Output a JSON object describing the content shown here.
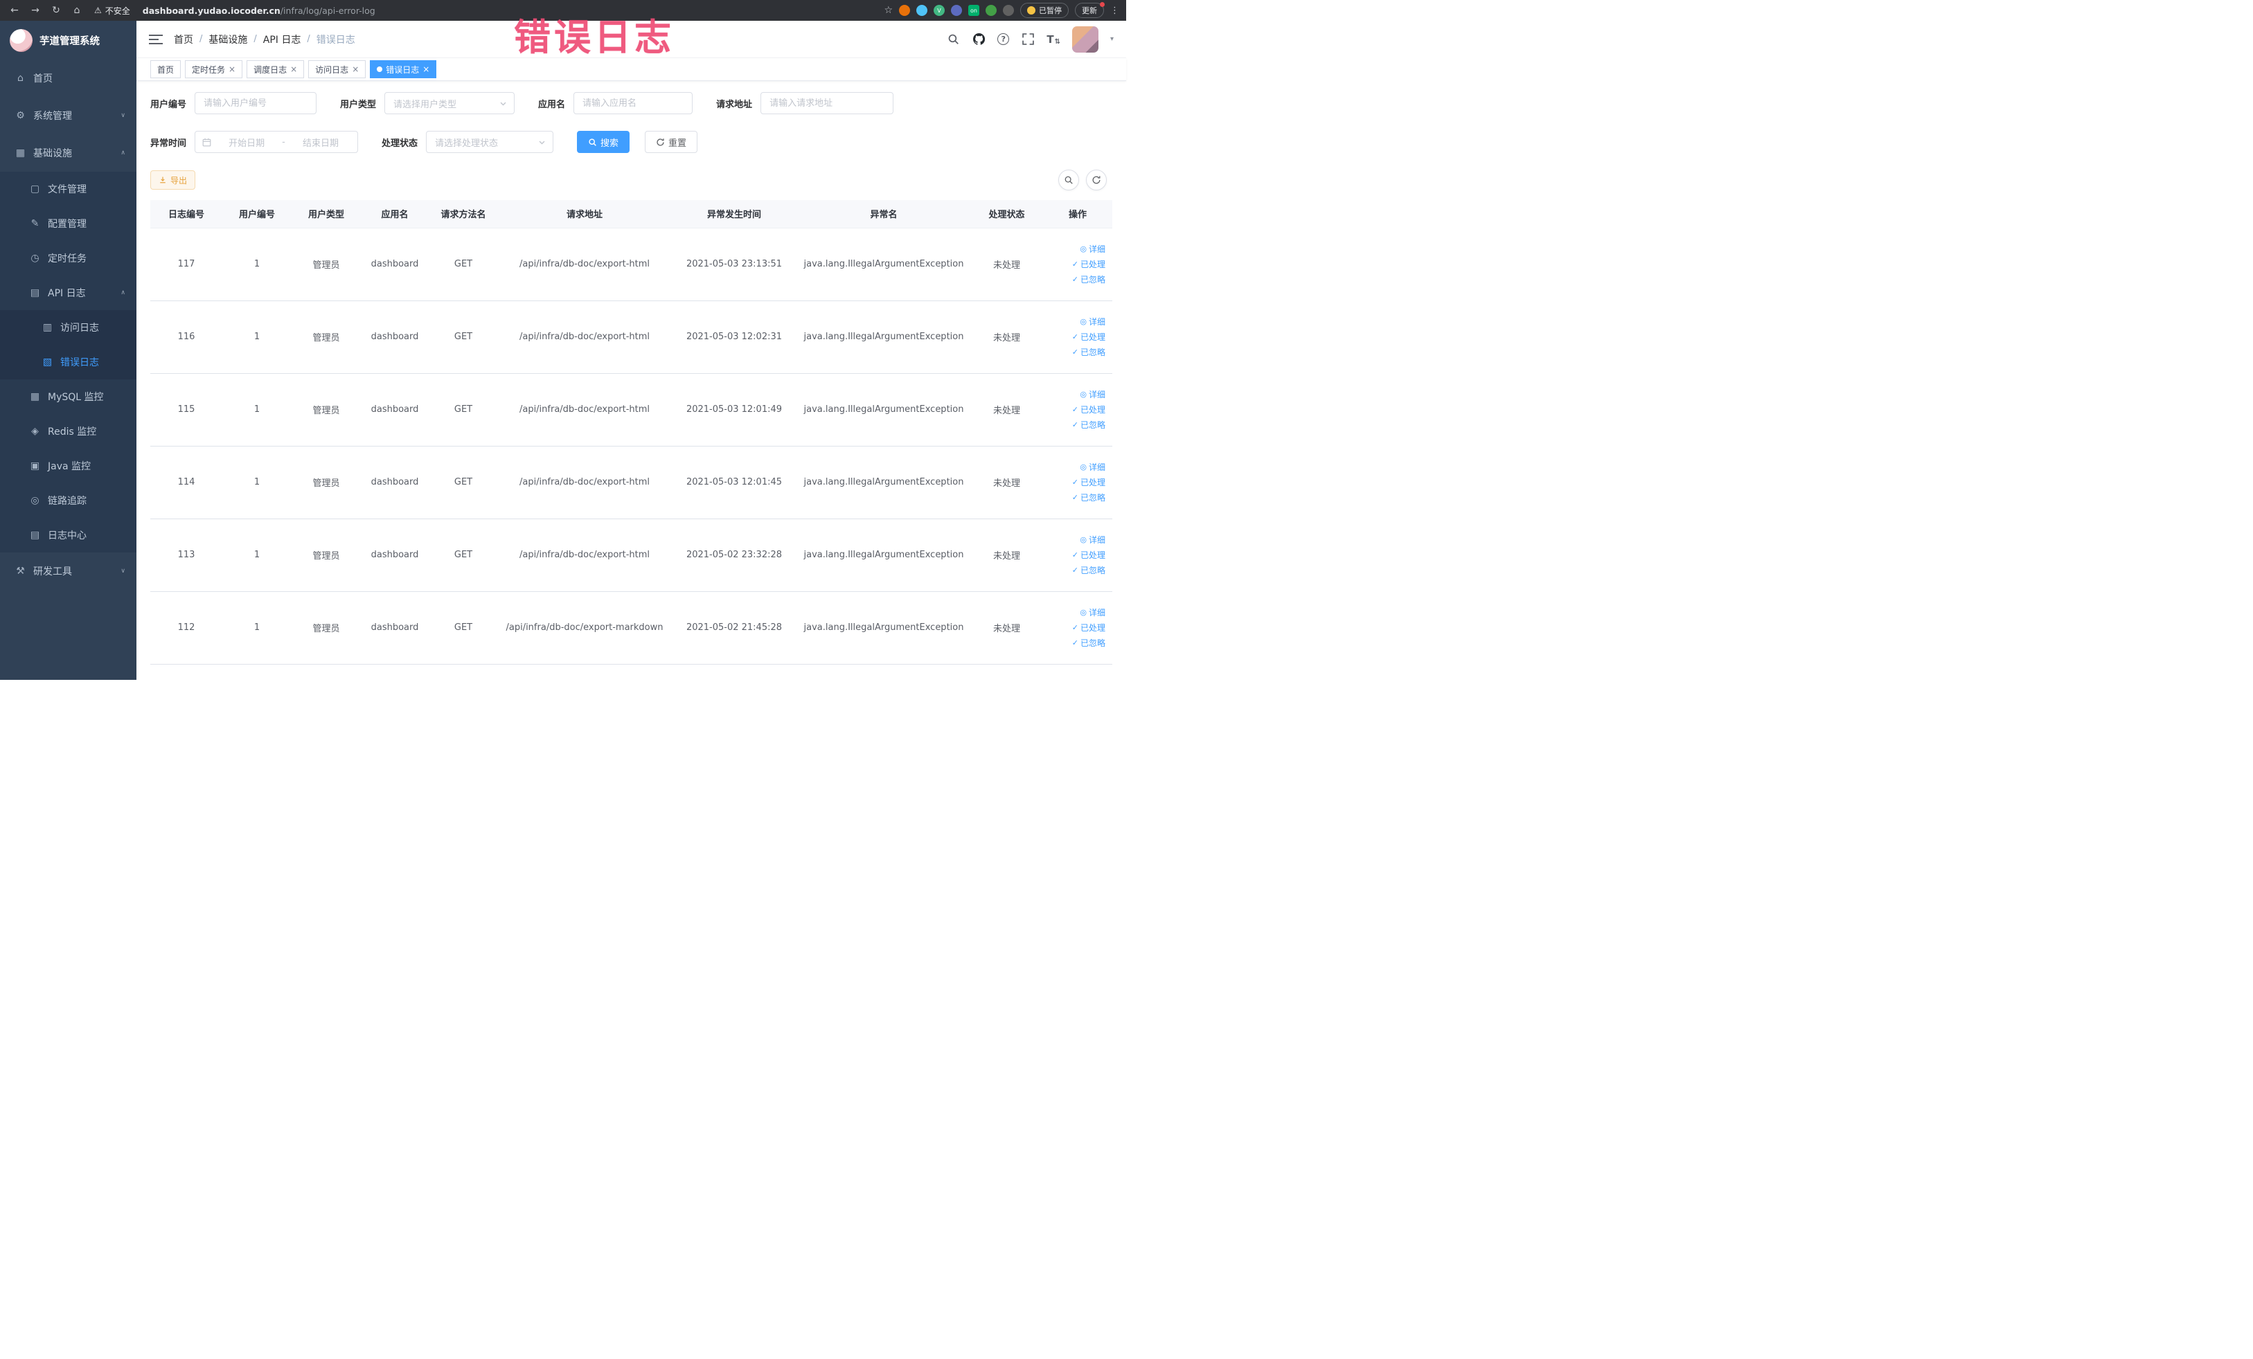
{
  "browser": {
    "security_label": "不安全",
    "url_domain": "dashboard.yudao.iocoder.cn",
    "url_path": "/infra/log/api-error-log",
    "paused_badge": "已暂停",
    "update_button": "更新"
  },
  "annotation": {
    "watermark": "错误日志"
  },
  "sidebar": {
    "logo_title": "芋道管理系统",
    "items": [
      {
        "label": "首页",
        "level": 1
      },
      {
        "label": "系统管理",
        "level": 1,
        "expandable": true,
        "expanded": false
      },
      {
        "label": "基础设施",
        "level": 1,
        "expandable": true,
        "expanded": true
      },
      {
        "label": "文件管理",
        "level": 2
      },
      {
        "label": "配置管理",
        "level": 2
      },
      {
        "label": "定时任务",
        "level": 2
      },
      {
        "label": "API 日志",
        "level": 2,
        "expandable": true,
        "expanded": true
      },
      {
        "label": "访问日志",
        "level": 3
      },
      {
        "label": "错误日志",
        "level": 3,
        "active": true
      },
      {
        "label": "MySQL 监控",
        "level": 2
      },
      {
        "label": "Redis 监控",
        "level": 2
      },
      {
        "label": "Java 监控",
        "level": 2
      },
      {
        "label": "链路追踪",
        "level": 2
      },
      {
        "label": "日志中心",
        "level": 2
      },
      {
        "label": "研发工具",
        "level": 1,
        "expandable": true,
        "expanded": false
      }
    ]
  },
  "header": {
    "breadcrumb": [
      "首页",
      "基础设施",
      "API 日志",
      "错误日志"
    ]
  },
  "tabs": [
    {
      "label": "首页",
      "closable": false,
      "active": false
    },
    {
      "label": "定时任务",
      "closable": true,
      "active": false
    },
    {
      "label": "调度日志",
      "closable": true,
      "active": false
    },
    {
      "label": "访问日志",
      "closable": true,
      "active": false
    },
    {
      "label": "错误日志",
      "closable": true,
      "active": true
    }
  ],
  "filters": {
    "user_id_label": "用户编号",
    "user_id_placeholder": "请输入用户编号",
    "user_type_label": "用户类型",
    "user_type_placeholder": "请选择用户类型",
    "app_name_label": "应用名",
    "app_name_placeholder": "请输入应用名",
    "request_url_label": "请求地址",
    "request_url_placeholder": "请输入请求地址",
    "exception_time_label": "异常时间",
    "date_start_placeholder": "开始日期",
    "date_separator": "-",
    "date_end_placeholder": "结束日期",
    "process_status_label": "处理状态",
    "process_status_placeholder": "请选择处理状态",
    "search_button": "搜索",
    "reset_button": "重置"
  },
  "toolbar": {
    "export_button": "导出"
  },
  "table": {
    "columns": [
      "日志编号",
      "用户编号",
      "用户类型",
      "应用名",
      "请求方法名",
      "请求地址",
      "异常发生时间",
      "异常名",
      "处理状态",
      "操作"
    ],
    "action_labels": [
      "详细",
      "已处理",
      "已忽略"
    ],
    "rows": [
      {
        "id": "117",
        "user_id": "1",
        "user_type": "管理员",
        "app": "dashboard",
        "method": "GET",
        "url": "/api/infra/db-doc/export-html",
        "time": "2021-05-03 23:13:51",
        "exception": "java.lang.IllegalArgumentException",
        "status": "未处理"
      },
      {
        "id": "116",
        "user_id": "1",
        "user_type": "管理员",
        "app": "dashboard",
        "method": "GET",
        "url": "/api/infra/db-doc/export-html",
        "time": "2021-05-03 12:02:31",
        "exception": "java.lang.IllegalArgumentException",
        "status": "未处理"
      },
      {
        "id": "115",
        "user_id": "1",
        "user_type": "管理员",
        "app": "dashboard",
        "method": "GET",
        "url": "/api/infra/db-doc/export-html",
        "time": "2021-05-03 12:01:49",
        "exception": "java.lang.IllegalArgumentException",
        "status": "未处理"
      },
      {
        "id": "114",
        "user_id": "1",
        "user_type": "管理员",
        "app": "dashboard",
        "method": "GET",
        "url": "/api/infra/db-doc/export-html",
        "time": "2021-05-03 12:01:45",
        "exception": "java.lang.IllegalArgumentException",
        "status": "未处理"
      },
      {
        "id": "113",
        "user_id": "1",
        "user_type": "管理员",
        "app": "dashboard",
        "method": "GET",
        "url": "/api/infra/db-doc/export-html",
        "time": "2021-05-02 23:32:28",
        "exception": "java.lang.IllegalArgumentException",
        "status": "未处理"
      },
      {
        "id": "112",
        "user_id": "1",
        "user_type": "管理员",
        "app": "dashboard",
        "method": "GET",
        "url": "/api/infra/db-doc/export-markdown",
        "time": "2021-05-02 21:45:28",
        "exception": "java.lang.IllegalArgumentException",
        "status": "未处理"
      }
    ]
  },
  "colors": {
    "accent": "#409eff",
    "warning": "#e6a23c",
    "sidebar_bg": "#304156",
    "watermark": "#ee4d75"
  }
}
